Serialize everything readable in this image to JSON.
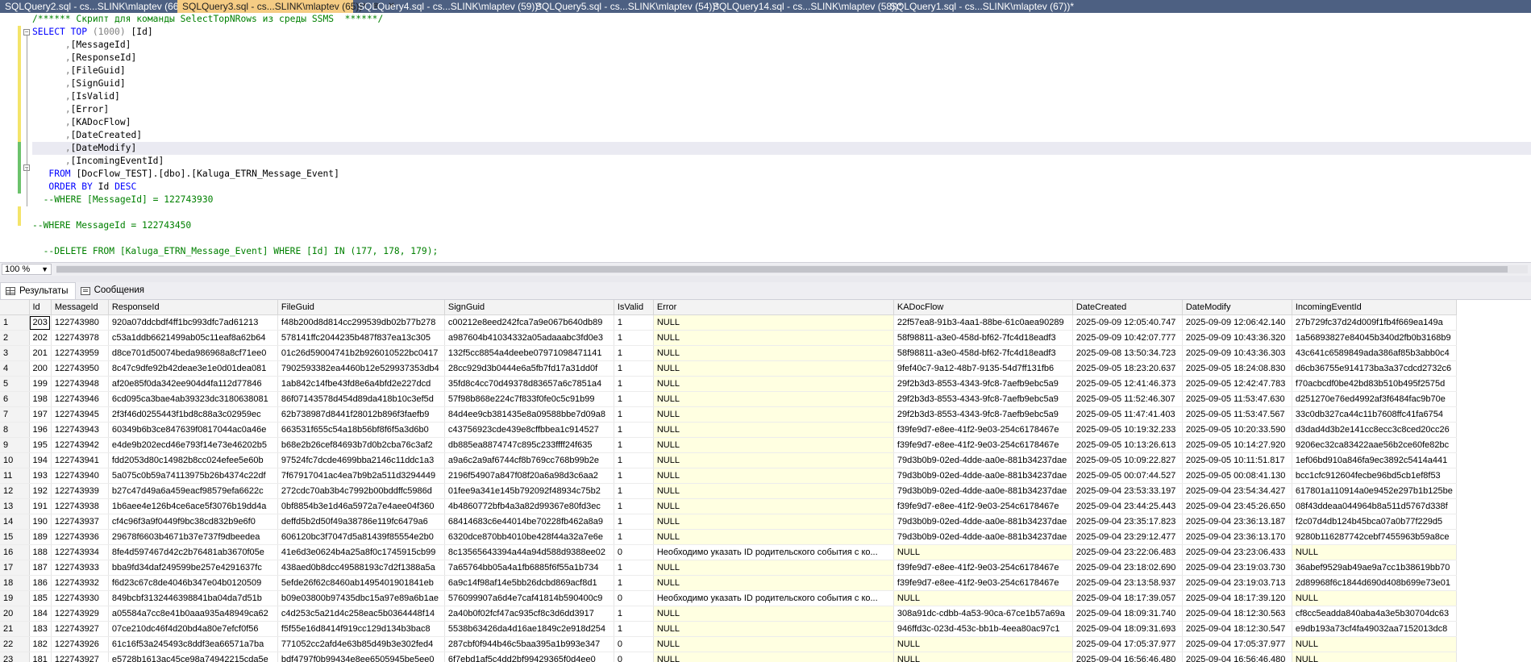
{
  "tabs": [
    {
      "label": "SQLQuery2.sql - cs...SLINK\\mlaptev (66))*",
      "active": false
    },
    {
      "label": "SQLQuery3.sql - cs...SLINK\\mlaptev (65))*",
      "active": true
    },
    {
      "label": "SQLQuery4.sql - cs...SLINK\\mlaptev (59))*",
      "active": false
    },
    {
      "label": "SQLQuery5.sql - cs...SLINK\\mlaptev (54))*",
      "active": false
    },
    {
      "label": "SQLQuery14.sql - cs...SLINK\\mlaptev (58))*",
      "active": false
    },
    {
      "label": "SQLQuery1.sql - cs...SLINK\\mlaptev (67))*",
      "active": false
    }
  ],
  "active_tab_icons": "⊕ ✕",
  "code": {
    "comment_header": "/****** Скрипт для команды SelectTopNRows из среды SSMS  ******/",
    "select": "SELECT",
    "top": "TOP",
    "top_arg": "(1000)",
    "first_col": "[Id]",
    "columns": [
      "[MessageId]",
      "[ResponseId]",
      "[FileGuid]",
      "[SignGuid]",
      "[IsValid]",
      "[Error]",
      "[KADocFlow]",
      "[DateCreated]",
      "[DateModify]",
      "[IncomingEventId]"
    ],
    "from_kw": "FROM",
    "from_table": "[DocFlow_TEST].[dbo].[Kaluga_ETRN_Message_Event]",
    "order_kw": "ORDER BY",
    "order_col": "Id",
    "order_dir": "DESC",
    "where1": "--WHERE [MessageId] = 122743930",
    "where2": "--WHERE MessageId = 122743450",
    "delete_line": "--DELETE FROM [Kaluga_ETRN_Message_Event] WHERE [Id] IN (177, 178, 179);"
  },
  "zoom": "100 %",
  "result_tabs": {
    "results": "Результаты",
    "messages": "Сообщения"
  },
  "grid": {
    "columns": [
      "Id",
      "MessageId",
      "ResponseId",
      "FileGuid",
      "SignGuid",
      "IsValid",
      "Error",
      "KADocFlow",
      "DateCreated",
      "DateModify",
      "IncomingEventId"
    ],
    "rows": [
      [
        "203",
        "122743980",
        "920a07ddcbdf4ff1bc993dfc7ad61213",
        "f48b200d8d814cc299539db02b77b278",
        "c00212e8eed242fca7a9e067b640db89",
        "1",
        "NULL",
        "22f57ea8-91b3-4aa1-88be-61c0aea90289",
        "2025-09-09 12:05:40.747",
        "2025-09-09 12:06:42.140",
        "27b729fc37d24d009f1fb4f669ea149a"
      ],
      [
        "202",
        "122743978",
        "c53a1ddb6621499ab05c11eaf8a62b64",
        "578141ffc2044235b487f837ea13c305",
        "a987604b41034332a05adaaabc3fd0e3",
        "1",
        "NULL",
        "58f98811-a3e0-458d-bf62-7fc4d18eadf3",
        "2025-09-09 10:42:07.777",
        "2025-09-09 10:43:36.320",
        "1a56893827e84045b340d2fb0b3168b9"
      ],
      [
        "201",
        "122743959",
        "d8ce701d50074beda986968a8cf71ee0",
        "01c26d59004741b2b926010522bc0417",
        "132f5cc8854a4deebe07971098471141",
        "1",
        "NULL",
        "58f98811-a3e0-458d-bf62-7fc4d18eadf3",
        "2025-09-08 13:50:34.723",
        "2025-09-09 10:43:36.303",
        "43c641c6589849ada386af85b3abb0c4"
      ],
      [
        "200",
        "122743950",
        "8c47c9dfe92b42deae3e1e0d01dea081",
        "7902593382ea4460b12e529937353db4",
        "28cc929d3b0444e6a5fb7fd17a31dd0f",
        "1",
        "NULL",
        "9fef40c7-9a12-48b7-9135-54d7ff131fb6",
        "2025-09-05 18:23:20.637",
        "2025-09-05 18:24:08.830",
        "d6cb36755e914173ba3a37cdcd2732c6"
      ],
      [
        "199",
        "122743948",
        "af20e85f0da342ee904d4fa112d77846",
        "1ab842c14fbe43fd8e6a4bfd2e227dcd",
        "35fd8c4cc70d49378d83657a6c7851a4",
        "1",
        "NULL",
        "29f2b3d3-8553-4343-9fc8-7aefb9ebc5a9",
        "2025-09-05 12:41:46.373",
        "2025-09-05 12:42:47.783",
        "f70acbcdf0be42bd83b510b495f2575d"
      ],
      [
        "198",
        "122743946",
        "6cd095ca3bae4ab39323dc3180638081",
        "86f07143578d454d89da418b10c3ef5d",
        "57f98b868e224c7f833f0fe0c5c91b99",
        "1",
        "NULL",
        "29f2b3d3-8553-4343-9fc8-7aefb9ebc5a9",
        "2025-09-05 11:52:46.307",
        "2025-09-05 11:53:47.630",
        "d251270e76ed4992af3f6484fac9b70e"
      ],
      [
        "197",
        "122743945",
        "2f3f46d0255443f1bd8c88a3c02959ec",
        "62b738987d8441f28012b896f3faefb9",
        "84d4ee9cb381435e8a09588bbe7d09a8",
        "1",
        "NULL",
        "29f2b3d3-8553-4343-9fc8-7aefb9ebc5a9",
        "2025-09-05 11:47:41.403",
        "2025-09-05 11:53:47.567",
        "33c0db327ca44c11b7608ffc41fa6754"
      ],
      [
        "196",
        "122743943",
        "60349b6b3ce847639f0817044ac0a46e",
        "663531f655c54a18b56bf8f6f5a3d6b0",
        "c43756923cde439e8cffbbea1c914527",
        "1",
        "NULL",
        "f39fe9d7-e8ee-41f2-9e03-254c6178467e",
        "2025-09-05 10:19:32.233",
        "2025-09-05 10:20:33.590",
        "d3dad4d3b2e141cc8ecc3c8ced20cc26"
      ],
      [
        "195",
        "122743942",
        "e4de9b202ecd46e793f14e73e46202b5",
        "b68e2b26cef84693b7d0b2cba76c3af2",
        "db885ea8874747c895c233ffff24f635",
        "1",
        "NULL",
        "f39fe9d7-e8ee-41f2-9e03-254c6178467e",
        "2025-09-05 10:13:26.613",
        "2025-09-05 10:14:27.920",
        "9206ec32ca83422aae56b2ce60fe82bc"
      ],
      [
        "194",
        "122743941",
        "fdd2053d80c14982b8cc024efee5e60b",
        "97524fc7dcde4699bba2146c11ddc1a3",
        "a9a6c2a9af6744cf8b769cc768b99b2e",
        "1",
        "NULL",
        "79d3b0b9-02ed-4dde-aa0e-881b34237dae",
        "2025-09-05 10:09:22.827",
        "2025-09-05 10:11:51.817",
        "1ef06bd910a846fa9ec3892c5414a441"
      ],
      [
        "193",
        "122743940",
        "5a075c0b59a74113975b26b4374c22df",
        "7f67917041ac4ea7b9b2a511d3294449",
        "2196f54907a847f08f20a6a98d3c6aa2",
        "1",
        "NULL",
        "79d3b0b9-02ed-4dde-aa0e-881b34237dae",
        "2025-09-05 00:07:44.527",
        "2025-09-05 00:08:41.130",
        "bcc1cfc912604fecbe96bd5cb1ef8f53"
      ],
      [
        "192",
        "122743939",
        "b27c47d49a6a459eacf98579efa6622c",
        "272cdc70ab3b4c7992b00bddffc5986d",
        "01fee9a341e145b792092f48934c75b2",
        "1",
        "NULL",
        "79d3b0b9-02ed-4dde-aa0e-881b34237dae",
        "2025-09-04 23:53:33.197",
        "2025-09-04 23:54:34.427",
        "617801a110914a0e9452e297b1b125be"
      ],
      [
        "191",
        "122743938",
        "1b6aee4e126b4ce6ace5f3076b19dd4a",
        "0bf8854b3e1d46a5972a7e4aee04f360",
        "4b4860772bfb4a3a82d99367e80fd3ec",
        "1",
        "NULL",
        "f39fe9d7-e8ee-41f2-9e03-254c6178467e",
        "2025-09-04 23:44:25.443",
        "2025-09-04 23:45:26.650",
        "08f43ddeaa044964b8a511d5767d338f"
      ],
      [
        "190",
        "122743937",
        "cf4c96f3a9f0449f9bc38cd832b9e6f0",
        "deffd5b2d50f49a38786e119fc6479a6",
        "68414683c6e44014be70228fb462a8a9",
        "1",
        "NULL",
        "79d3b0b9-02ed-4dde-aa0e-881b34237dae",
        "2025-09-04 23:35:17.823",
        "2025-09-04 23:36:13.187",
        "f2c07d4db124b45bca07a0b77f229d5"
      ],
      [
        "189",
        "122743936",
        "29678f6603b4671b37e737f9dbeedea",
        "606120bc3f7047d5a81439f85554e2b0",
        "6320dce870bb4010be428f44a32a7e6e",
        "1",
        "NULL",
        "79d3b0b9-02ed-4dde-aa0e-881b34237dae",
        "2025-09-04 23:29:12.477",
        "2025-09-04 23:36:13.170",
        "9280b116287742cebf7455963b59a8ce"
      ],
      [
        "188",
        "122743934",
        "8fe4d597467d42c2b76481ab3670f05e",
        "41e6d3e0624b4a25a8f0c1745915cb99",
        "8c13565643394a44a94d588d9388ee02",
        "0",
        "Необходимо указать ID родительского события с ко...",
        "NULL",
        "2025-09-04 23:22:06.483",
        "2025-09-04 23:23:06.433",
        "NULL"
      ],
      [
        "187",
        "122743933",
        "bba9fd34daf249599be257e4291637fc",
        "438aed0b8dcc49588193c7d2f1388a5a",
        "7a65764bb05a4a1fb6885f6f55a1b734",
        "1",
        "NULL",
        "f39fe9d7-e8ee-41f2-9e03-254c6178467e",
        "2025-09-04 23:18:02.690",
        "2025-09-04 23:19:03.730",
        "36abef9529ab49ae9a7cc1b38619bb70"
      ],
      [
        "186",
        "122743932",
        "f6d23c67c8de4046b347e04b0120509",
        "5efde26f62c8460ab1495401901841eb",
        "6a9c14f98af14e5bb26dcbd869acf8d1",
        "1",
        "NULL",
        "f39fe9d7-e8ee-41f2-9e03-254c6178467e",
        "2025-09-04 23:13:58.937",
        "2025-09-04 23:19:03.713",
        "2d89968f6c1844d690d408b699e73e01"
      ],
      [
        "185",
        "122743930",
        "849bcbf3132446398841ba04da7d51b",
        "b09e03800b97435dbc15a97e89a6b1ae",
        "576099907a6d4e7caf41814b590400c9",
        "0",
        "Необходимо указать ID родительского события с ко...",
        "NULL",
        "2025-09-04 18:17:39.057",
        "2025-09-04 18:17:39.120",
        "NULL"
      ],
      [
        "184",
        "122743929",
        "a05584a7cc8e41b0aaa935a48949ca62",
        "c4d253c5a21d4c258eac5b0364448f14",
        "2a40b0f02fcf47ac935cf8c3d6dd3917",
        "1",
        "NULL",
        "308a91dc-cdbb-4a53-90ca-67ce1b57a69a",
        "2025-09-04 18:09:31.740",
        "2025-09-04 18:12:30.563",
        "cf8cc5eadda840aba4a3e5b30704dc63"
      ],
      [
        "183",
        "122743927",
        "07ce210dc46f4d20bd4a80e7efcf0f56",
        "f5f55e16d8414f919cc129d134b3bac8",
        "5538b63426da4d16ae1849c2e918d254",
        "1",
        "NULL",
        "946ffd3c-023d-453c-bb1b-4eea80ac97c1",
        "2025-09-04 18:09:31.693",
        "2025-09-04 18:12:30.547",
        "e9db193a73cf4fa49032aa7152013dc8"
      ],
      [
        "182",
        "122743926",
        "61c16f53a245493c8ddf3ea66571a7ba",
        "771052cc2afd4e63b85d49b3e302fed4",
        "287cbf0f944b46c5baa395a1b993e347",
        "0",
        "NULL",
        "NULL",
        "2025-09-04 17:05:37.977",
        "2025-09-04 17:05:37.977",
        "NULL"
      ],
      [
        "181",
        "122743927",
        "e5728b1613ac45ce98a74942215cda5e",
        "bdf4797f0b99434e8ee6505945be5ee0",
        "6f7ebd1af5c4dd2bf99429365f0d4ee0",
        "0",
        "NULL",
        "NULL",
        "2025-09-04 16:56:46.480",
        "2025-09-04 16:56:46.480",
        "NULL"
      ]
    ]
  }
}
